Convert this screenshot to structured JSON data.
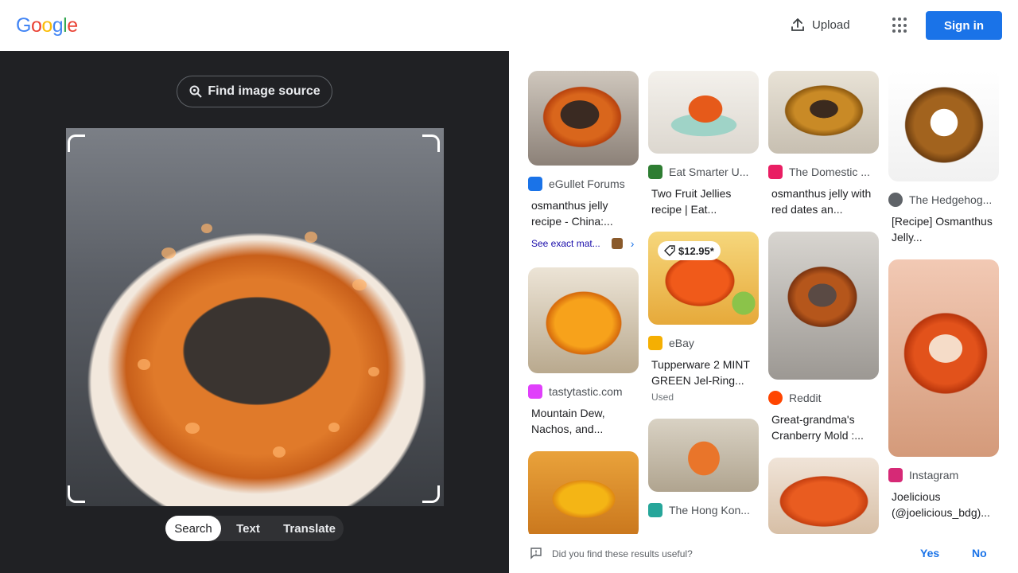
{
  "header": {
    "logo_letters": [
      "G",
      "o",
      "o",
      "g",
      "l",
      "e"
    ],
    "logo_colors": [
      "#4285F4",
      "#EA4335",
      "#FBBC05",
      "#4285F4",
      "#34A853",
      "#EA4335"
    ],
    "upload_label": "Upload",
    "signin_label": "Sign in",
    "accent": "#1a73e8"
  },
  "lens": {
    "find_source_label": "Find image source",
    "modes": [
      "Search",
      "Text",
      "Translate"
    ],
    "active_mode": "Search"
  },
  "results": [
    {
      "source": "eGullet Forums",
      "title": "osmanthus jelly recipe - China:...",
      "exact_label": "See exact mat...",
      "favicon": "egullet-icon",
      "favcolor": "#1a73e8"
    },
    {
      "source": "Eat Smarter U...",
      "title": "Two Fruit Jellies recipe | Eat...",
      "favicon": "eatsmarter-icon",
      "favcolor": "#2e7d32"
    },
    {
      "source": "The Domestic ...",
      "title": "osmanthus jelly with red dates an...",
      "favicon": "domestic-icon",
      "favcolor": "#e91e63"
    },
    {
      "source": "The Hedgehog...",
      "title": "[Recipe] Osmanthus Jelly...",
      "favicon": "globe-icon",
      "favcolor": "#5f6368"
    },
    {
      "source": "tastytastic.com",
      "title": "Mountain Dew, Nachos, and...",
      "favicon": "cupcake-icon",
      "favcolor": "#e040fb"
    },
    {
      "source": "eBay",
      "title": "Tupperware 2 MINT GREEN Jel-Ring...",
      "subtitle": "Used",
      "price": "$12.95*",
      "favicon": "ebay-icon",
      "favcolor": "#f5af02"
    },
    {
      "source": "Reddit",
      "title": "Great-grandma's Cranberry Mold :...",
      "favicon": "reddit-icon",
      "favcolor": "#ff4500"
    },
    {
      "source": "Instagram",
      "title": "Joelicious (@joelicious_bdg)...",
      "favicon": "instagram-icon",
      "favcolor": "#d62976"
    },
    {
      "source": "The Hong Kon...",
      "title": "",
      "favicon": "hongkong-icon",
      "favcolor": "#26a69a"
    }
  ],
  "feedback": {
    "question": "Did you find these results useful?",
    "yes": "Yes",
    "no": "No"
  }
}
